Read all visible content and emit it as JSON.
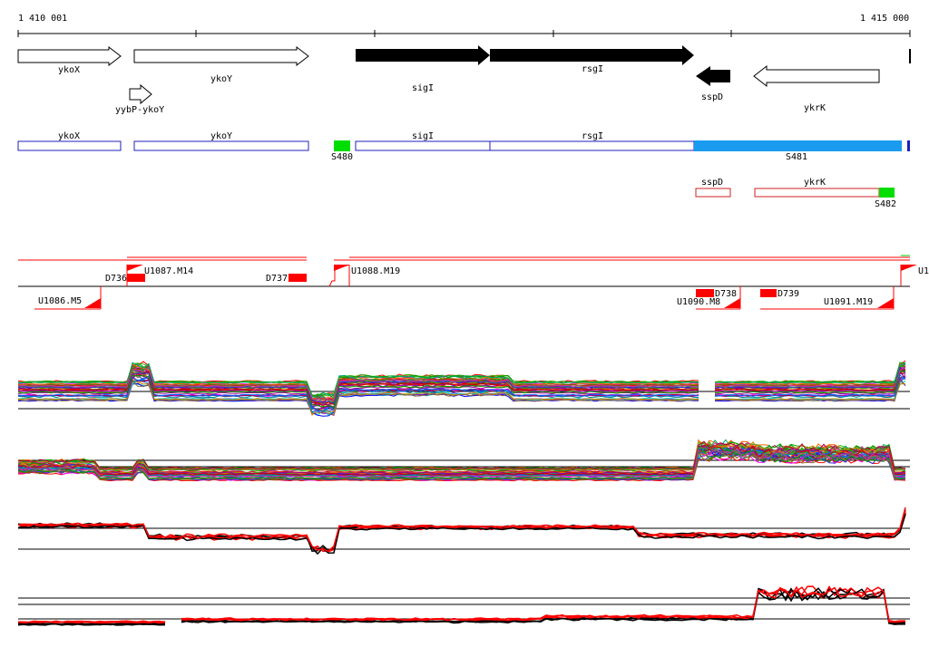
{
  "coordinates": {
    "start_label": "1 410 001",
    "end_label": "1 415 000"
  },
  "genes": [
    {
      "name": "ykoX",
      "strand": "+",
      "style": "outline"
    },
    {
      "name": "ykoY",
      "strand": "+",
      "style": "outline"
    },
    {
      "name": "yybP-ykoY",
      "strand": "+",
      "style": "outline"
    },
    {
      "name": "sigI",
      "strand": "+",
      "style": "filled"
    },
    {
      "name": "rsgI",
      "strand": "+",
      "style": "filled"
    },
    {
      "name": "sspD",
      "strand": "-",
      "style": "filled"
    },
    {
      "name": "ykrK",
      "strand": "-",
      "style": "outline"
    }
  ],
  "transcript_boxes_plus": [
    {
      "label": "ykoX",
      "color": "#1f1fbf"
    },
    {
      "label": "ykoY",
      "color": "#1f1fbf"
    },
    {
      "label": "sigI",
      "color": "#1f1fbf"
    },
    {
      "label": "rsgI",
      "color": "#1f1fbf"
    }
  ],
  "segments": [
    {
      "label": "S480",
      "color": "#00dd00"
    },
    {
      "label": "S481",
      "color": "#1a9bef"
    },
    {
      "label": "S482",
      "color": "#00dd00"
    }
  ],
  "transcript_boxes_minus": [
    {
      "label": "sspD",
      "color": "#cc2222"
    },
    {
      "label": "ykrK",
      "color": "#cc2222"
    }
  ],
  "upshifts_top": [
    "D736",
    "U1087.M14",
    "D737",
    "U1088.M19",
    "U1"
  ],
  "upshifts_bottom": [
    "U1086.M5",
    "D738",
    "U1090.M8",
    "D739",
    "U1091.M19"
  ],
  "colors": {
    "accent_red": "#ff0000",
    "green": "#00dd00",
    "blue": "#1a9bef",
    "black": "#000000"
  },
  "expression_panels": [
    {
      "id": "tiling-plus",
      "series_style": "multicolor"
    },
    {
      "id": "tiling-minus",
      "series_style": "multicolor"
    },
    {
      "id": "summary-plus",
      "series_style": "black-red"
    },
    {
      "id": "summary-minus",
      "series_style": "black-red"
    }
  ]
}
